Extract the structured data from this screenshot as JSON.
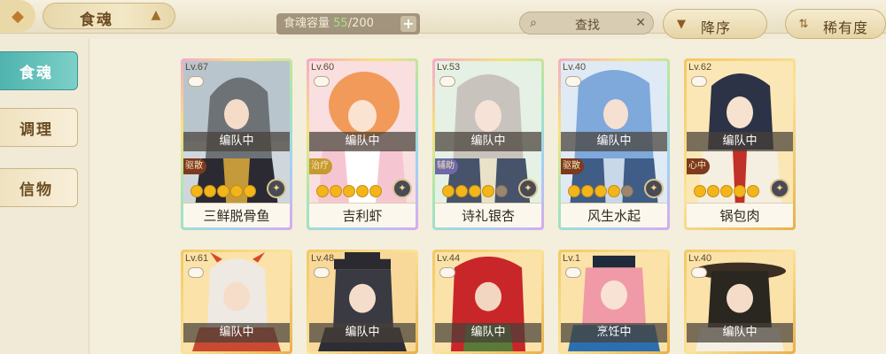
{
  "header": {
    "back_icon": "diamond-back-icon",
    "title": "食魂",
    "crown_icon": "crown-icon",
    "capacity_label": "食魂容量",
    "capacity_current": "55",
    "capacity_total": "/200",
    "plus_label": "+",
    "search_label": "查找",
    "clear_label": "✕",
    "sort_desc_label": "降序",
    "sort_rarity_label": "稀有度"
  },
  "sidebar": {
    "items": [
      {
        "label": "食魂",
        "active": true
      },
      {
        "label": "调理",
        "active": false
      },
      {
        "label": "信物",
        "active": false
      }
    ]
  },
  "cards": [
    {
      "level": "Lv.67",
      "status": "编队中",
      "role": "驱散",
      "stars": 5,
      "name": "三鲜脱骨鱼",
      "frame": "rainbow"
    },
    {
      "level": "Lv.60",
      "status": "编队中",
      "role": "治疗",
      "stars": 5,
      "name": "吉利虾",
      "frame": "rainbow"
    },
    {
      "level": "Lv.53",
      "status": "编队中",
      "role": "辅助",
      "stars": 4,
      "name": "诗礼银杏",
      "frame": "rainbow"
    },
    {
      "level": "Lv.40",
      "status": "编队中",
      "role": "驱散",
      "stars": 4,
      "name": "风生水起",
      "frame": "rainbow"
    },
    {
      "level": "Lv.62",
      "status": "编队中",
      "role": "心中",
      "stars": 5,
      "name": "锅包肉",
      "frame": "gold"
    },
    {
      "level": "Lv.61",
      "status": "编队中",
      "frame": "gold"
    },
    {
      "level": "Lv.48",
      "status": "编队中",
      "frame": "gold"
    },
    {
      "level": "Lv.44",
      "status": "编队中",
      "frame": "gold"
    },
    {
      "level": "Lv.1",
      "status": "烹饪中",
      "frame": "gold"
    },
    {
      "level": "Lv.40",
      "status": "编队中",
      "frame": "gold"
    }
  ],
  "colors": {
    "accent_teal": "#4fb3ae",
    "capacity_current": "#9fe37d",
    "star": "#f2b61b"
  }
}
